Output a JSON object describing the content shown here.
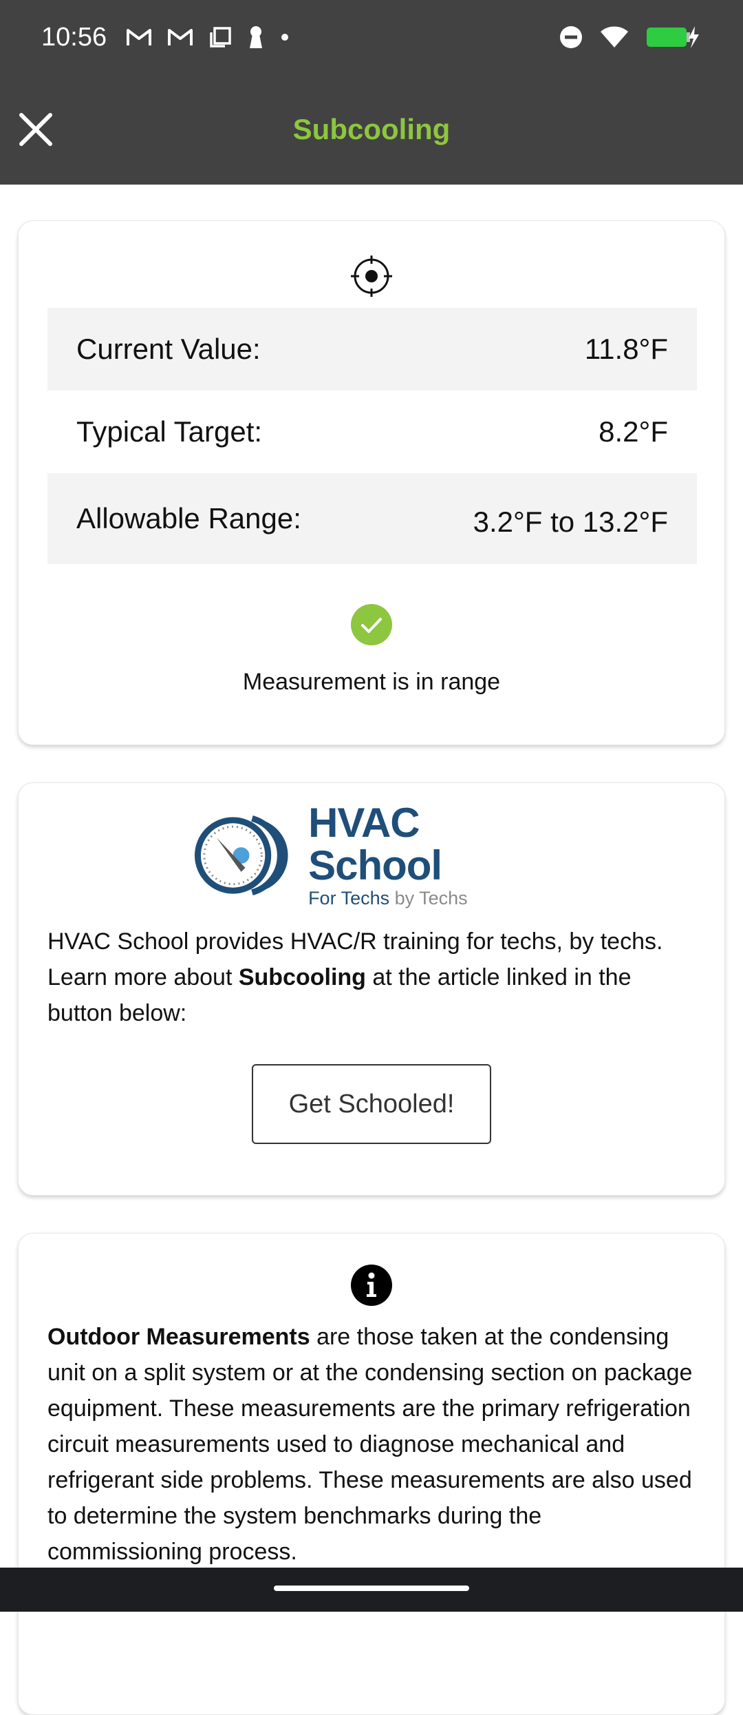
{
  "status_bar": {
    "time": "10:56",
    "icons_left": [
      "gmail-icon",
      "gmail-icon",
      "screenshot-icon",
      "keyhole-icon",
      "dot-icon"
    ],
    "icons_right": [
      "do-not-disturb-icon",
      "wifi-icon",
      "battery-charging-icon"
    ]
  },
  "app_bar": {
    "title": "Subcooling",
    "close_icon": "close-icon",
    "title_color": "#8dc63f",
    "background": "#424242"
  },
  "measurement_card": {
    "icon": "target-icon",
    "rows": [
      {
        "label": "Current Value:",
        "value": "11.8°F"
      },
      {
        "label": "Typical Target:",
        "value": "8.2°F"
      },
      {
        "label": "Allowable Range:",
        "value": "3.2°F to 13.2°F"
      }
    ],
    "status_icon": "check-circle-icon",
    "status_color": "#8dc63f",
    "status_text": "Measurement is in range"
  },
  "school_card": {
    "logo": {
      "title": "HVAC School",
      "tagline_a": "For Techs",
      "tagline_b": "by Techs",
      "color": "#1f4e79"
    },
    "text_before": "HVAC School provides HVAC/R training for techs, by techs. Learn more about ",
    "text_bold": "Subcooling",
    "text_after": " at the article linked in the button below:",
    "button_label": "Get Schooled!"
  },
  "info_card": {
    "icon": "info-icon",
    "text_bold": "Outdoor Measurements",
    "text_after": " are those taken at the condensing unit on a split system or at the condensing section on package equipment. These measurements are the primary refrigeration circuit measurements used to diagnose mechanical and refrigerant side problems. These measurements are also used to determine the system benchmarks during the commissioning process."
  }
}
